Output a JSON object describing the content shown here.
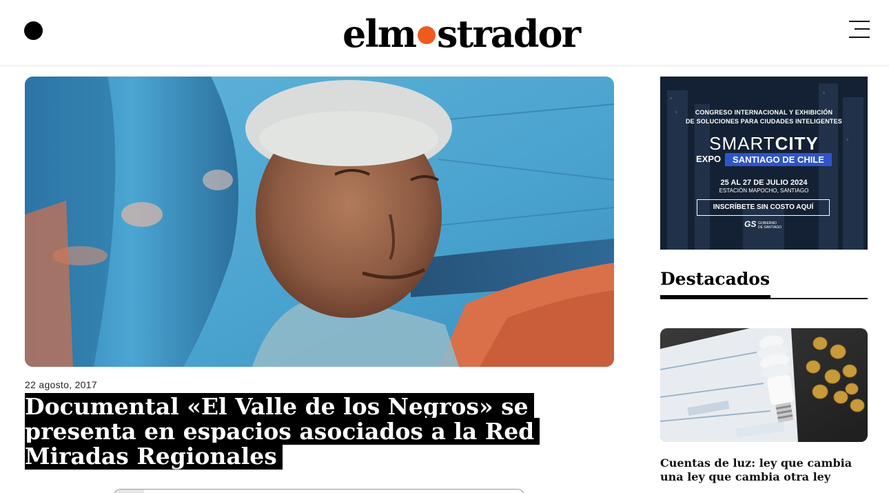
{
  "header": {
    "logo_text_before": "elm",
    "logo_text_after": "strador",
    "brand_accent": "#f05a1d",
    "left_icon": "circle-icon",
    "menu_icon": "hamburger-menu-icon"
  },
  "article": {
    "date": "22 agosto, 2017",
    "title": "Documental «El Valle de los Negros» se presenta en espacios asociados a la Red Miradas Regionales"
  },
  "ad": {
    "line1": "CONGRESO INTERNACIONAL Y EXHIBICIÓN",
    "line2": "DE SOLUCIONES PARA CIUDADES INTELIGENTES",
    "smart": "SMART",
    "city": "CITY",
    "expo": "EXPO",
    "expo_highlight": "SANTIAGO DE CHILE",
    "dates": "25 AL 27 DE JULIO 2024",
    "venue": "ESTACIÓN MAPOCHO, SANTIAGO",
    "cta": "INSCRÍBETE SIN COSTO AQUÍ",
    "logo": "GS",
    "logo_sub": "GOBIERNO DE SANTIAGO",
    "highlight_color": "#2e55c8"
  },
  "sidebar": {
    "section_title": "Destacados",
    "cards": [
      {
        "title": "Cuentas de luz: ley que cambia una ley que cambia otra ley"
      }
    ]
  }
}
